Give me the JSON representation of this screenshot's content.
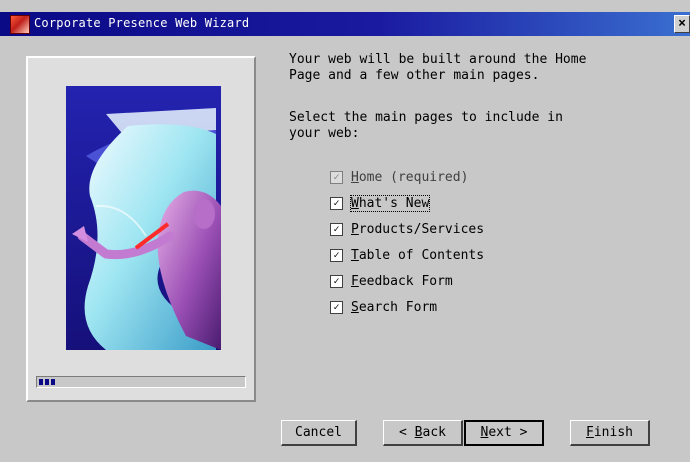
{
  "window": {
    "title": "Corporate Presence Web Wizard",
    "close_label": "×"
  },
  "progress": {
    "fraction": 0.1
  },
  "content": {
    "intro": "Your web will be built around the Home\nPage and a few other main pages.",
    "prompt": "Select the main pages to include in\nyour web:",
    "pages": [
      {
        "mnemonic": "H",
        "rest": "ome (required)",
        "checked": true,
        "disabled": true
      },
      {
        "mnemonic": "W",
        "rest": "hat's New",
        "checked": true,
        "disabled": false,
        "focused": true
      },
      {
        "mnemonic": "P",
        "rest": "roducts/Services",
        "checked": true,
        "disabled": false
      },
      {
        "mnemonic": "T",
        "rest": "able of Contents",
        "checked": true,
        "disabled": false
      },
      {
        "mnemonic": "F",
        "rest": "eedback Form",
        "checked": true,
        "disabled": false
      },
      {
        "mnemonic": "S",
        "rest": "earch Form",
        "checked": true,
        "disabled": false
      }
    ]
  },
  "buttons": {
    "cancel": "Cancel",
    "back_prefix": "< ",
    "back_mnemonic": "B",
    "back_rest": "ack",
    "next_mnemonic": "N",
    "next_rest": "ext >",
    "finish_mnemonic": "F",
    "finish_rest": "inish"
  }
}
